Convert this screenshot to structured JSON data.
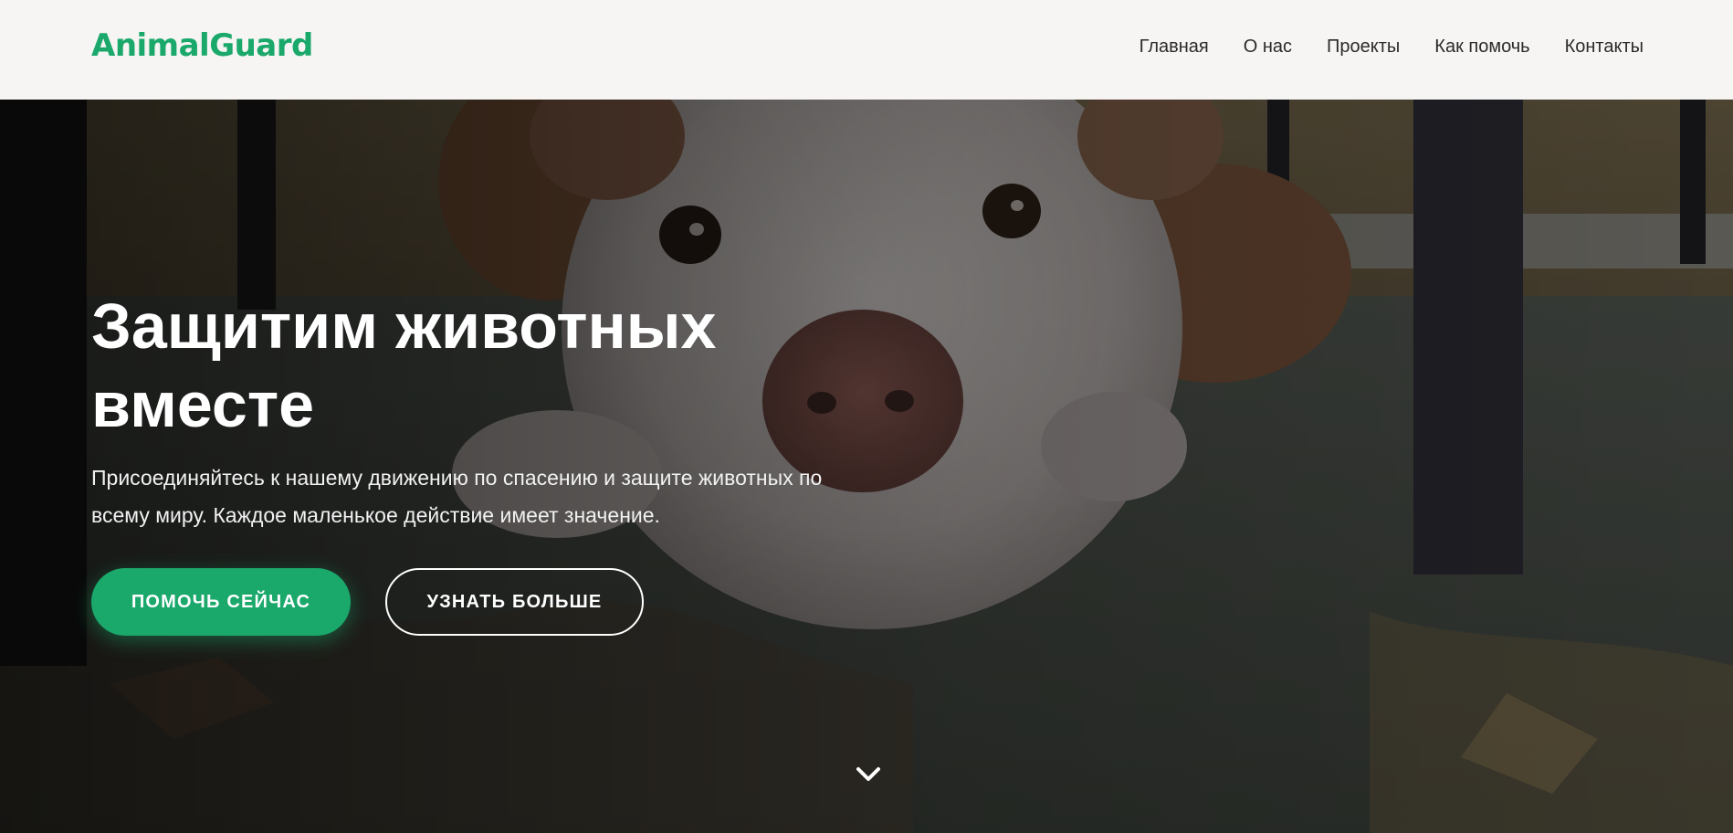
{
  "header": {
    "logo": "AnimalGuard",
    "nav": [
      {
        "label": "Главная"
      },
      {
        "label": "О нас"
      },
      {
        "label": "Проекты"
      },
      {
        "label": "Как помочь"
      },
      {
        "label": "Контакты"
      }
    ]
  },
  "hero": {
    "title": "Защитим животных вместе",
    "subtitle": "Присоединяйтесь к нашему движению по спасению и защите животных по всему миру. Каждое маленькое действие имеет значение.",
    "primary_button": "ПОМОЧЬ СЕЙЧАС",
    "secondary_button": "УЗНАТЬ БОЛЬШЕ",
    "scroll_icon": "chevron-down-icon"
  },
  "colors": {
    "accent": "#1aa86b",
    "header_bg": "#f6f5f3",
    "nav_text": "#2b2b2b",
    "hero_text": "#ffffff"
  }
}
